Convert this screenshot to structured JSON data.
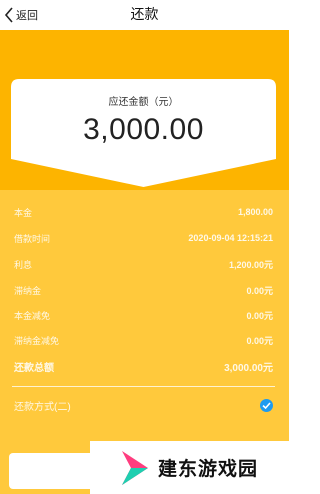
{
  "navbar": {
    "back_label": "返回",
    "title": "还款"
  },
  "amount_card": {
    "label": "应还金额（元）",
    "value": "3,000.00"
  },
  "details": [
    {
      "label": "本金",
      "value": "1,800.00"
    },
    {
      "label": "借款时间",
      "value": "2020-09-04 12:15:21"
    },
    {
      "label": "利息",
      "value": "1,200.00元"
    },
    {
      "label": "滞纳金",
      "value": "0.00元"
    },
    {
      "label": "本金减免",
      "value": "0.00元"
    },
    {
      "label": "滞纳金减免",
      "value": "0.00元"
    },
    {
      "label": "还款总额",
      "value": "3,000.00元"
    }
  ],
  "payment_method": {
    "label": "还款方式(二)",
    "selected": true
  },
  "watermark": {
    "text": "建东游戏园"
  },
  "colors": {
    "primary_orange": "#fdb400",
    "panel_yellow": "#ffc93c",
    "check_blue": "#1e9bf0"
  }
}
